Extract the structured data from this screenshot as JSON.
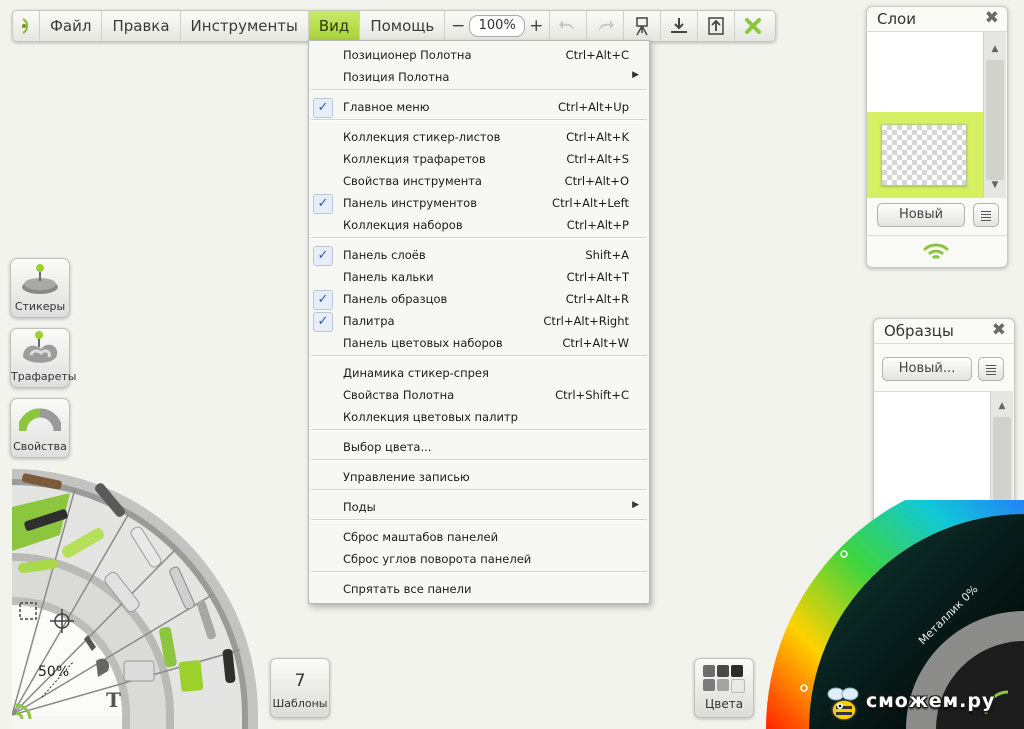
{
  "menubar": {
    "items": [
      {
        "label": "Файл"
      },
      {
        "label": "Правка"
      },
      {
        "label": "Инструменты"
      },
      {
        "label": "Вид"
      },
      {
        "label": "Помощь"
      }
    ],
    "zoom_minus": "−",
    "zoom_value": "100%",
    "zoom_plus": "+"
  },
  "view_menu": {
    "items": [
      {
        "label": "Позиционер Полотна",
        "shortcut": "Ctrl+Alt+C",
        "checked": false
      },
      {
        "label": "Позиция Полотна",
        "shortcut": "",
        "submenu": true
      },
      {
        "label": "Главное меню",
        "shortcut": "Ctrl+Alt+Up",
        "checked": true
      },
      {
        "label": "Коллекция стикер-листов",
        "shortcut": "Ctrl+Alt+K",
        "checked": false
      },
      {
        "label": "Коллекция трафаретов",
        "shortcut": "Ctrl+Alt+S",
        "checked": false
      },
      {
        "label": "Свойства инструмента",
        "shortcut": "Ctrl+Alt+O",
        "checked": false
      },
      {
        "label": "Панель инструментов",
        "shortcut": "Ctrl+Alt+Left",
        "checked": true
      },
      {
        "label": "Коллекция наборов",
        "shortcut": "Ctrl+Alt+P",
        "checked": false
      },
      {
        "label": "Панель слоёв",
        "shortcut": "Shift+A",
        "checked": true
      },
      {
        "label": "Панель кальки",
        "shortcut": "Ctrl+Alt+T",
        "checked": false
      },
      {
        "label": "Панель образцов",
        "shortcut": "Ctrl+Alt+R",
        "checked": true
      },
      {
        "label": "Палитра",
        "shortcut": "Ctrl+Alt+Right",
        "checked": true
      },
      {
        "label": "Панель цветовых наборов",
        "shortcut": "Ctrl+Alt+W",
        "checked": false
      },
      {
        "label": "Динамика стикер-спрея",
        "shortcut": "",
        "checked": false
      },
      {
        "label": "Свойства Полотна",
        "shortcut": "Ctrl+Shift+C",
        "checked": false
      },
      {
        "label": "Коллекция цветовых палитр",
        "shortcut": "",
        "checked": false
      },
      {
        "label": "Выбор цвета...",
        "shortcut": "",
        "checked": false
      },
      {
        "label": "Управление записью",
        "shortcut": "",
        "checked": false
      },
      {
        "label": "Поды",
        "shortcut": "",
        "submenu": true
      },
      {
        "label": "Сброс маштабов панелей",
        "shortcut": "",
        "checked": false
      },
      {
        "label": "Сброс углов поворота панелей",
        "shortcut": "",
        "checked": false
      },
      {
        "label": "Спрятать все панели",
        "shortcut": "",
        "checked": false
      }
    ]
  },
  "layers_panel": {
    "title": "Слои",
    "new_button": "Новый"
  },
  "samples_panel": {
    "title": "Образцы",
    "new_button": "Новый..."
  },
  "tools": {
    "stickers": "Стикеры",
    "stencils": "Трафареты",
    "properties": "Свойства"
  },
  "brush_wheel": {
    "size_value": "50%"
  },
  "templates": {
    "count": "7",
    "label": "Шаблоны"
  },
  "colors_button": "Цвета",
  "color_wheel": {
    "metallic_label": "Металлик 0%"
  },
  "watermark": "сможем.ру",
  "colors": {
    "accent_green": "#a7d13a",
    "check_blue": "#2a55b0"
  }
}
